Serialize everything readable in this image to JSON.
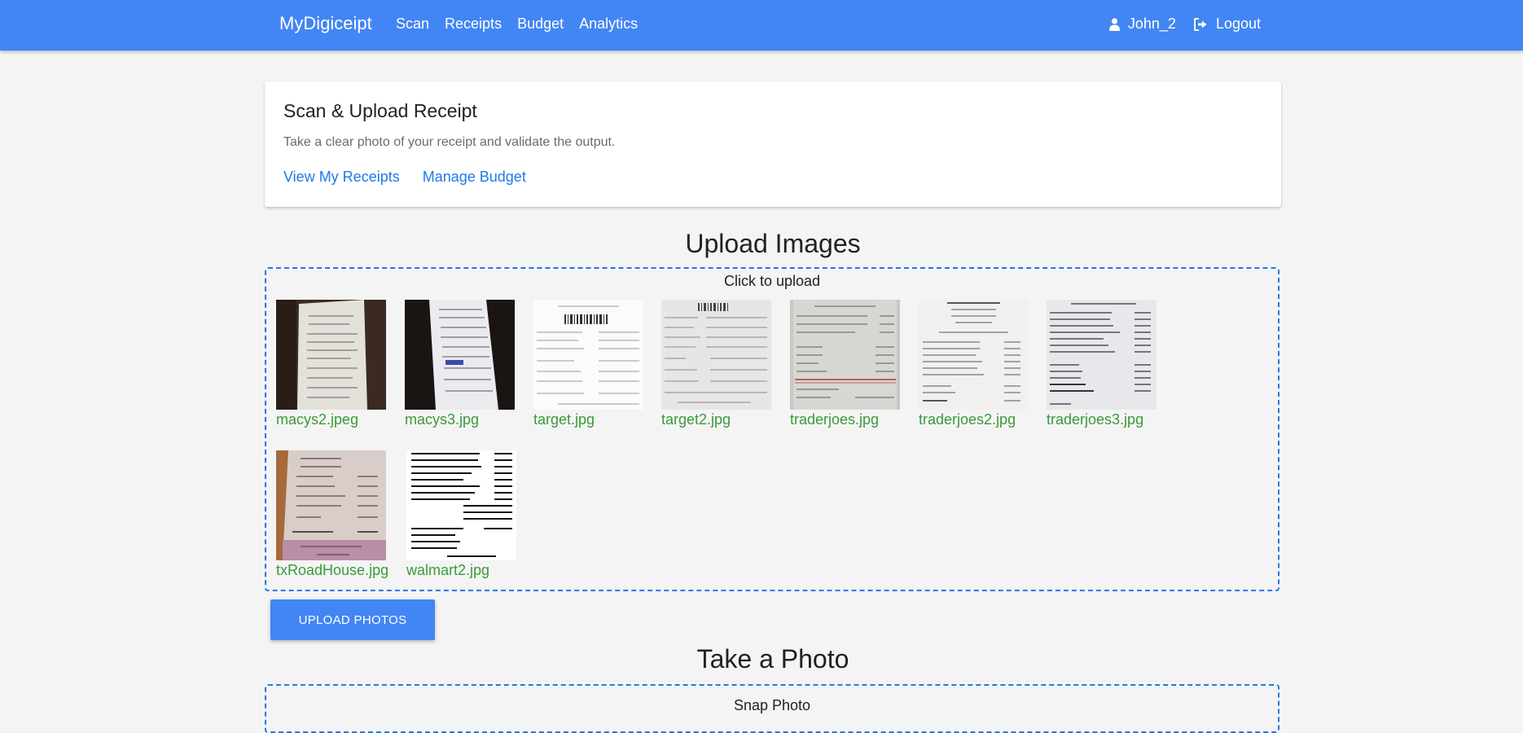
{
  "nav": {
    "brand": "MyDigiceipt",
    "links": [
      "Scan",
      "Receipts",
      "Budget",
      "Analytics"
    ],
    "user": "John_2",
    "logout": "Logout"
  },
  "card": {
    "title": "Scan & Upload Receipt",
    "text": "Take a clear photo of your receipt and validate the output.",
    "links": [
      "View My Receipts",
      "Manage Budget"
    ]
  },
  "upload": {
    "heading": "Upload Images",
    "dropzone_message": "Click to upload",
    "files": [
      "macys2.jpeg",
      "macys3.jpg",
      "target.jpg",
      "target2.jpg",
      "traderjoes.jpg",
      "traderjoes2.jpg",
      "traderjoes3.jpg",
      "txRoadHouse.jpg",
      "walmart2.jpg"
    ],
    "button": "UPLOAD PHOTOS"
  },
  "camera": {
    "heading": "Take a Photo",
    "dropzone_message": "Snap Photo"
  },
  "colors": {
    "primary": "#4285f4",
    "link": "#1e7ae6",
    "filename": "#3a9a3a"
  }
}
